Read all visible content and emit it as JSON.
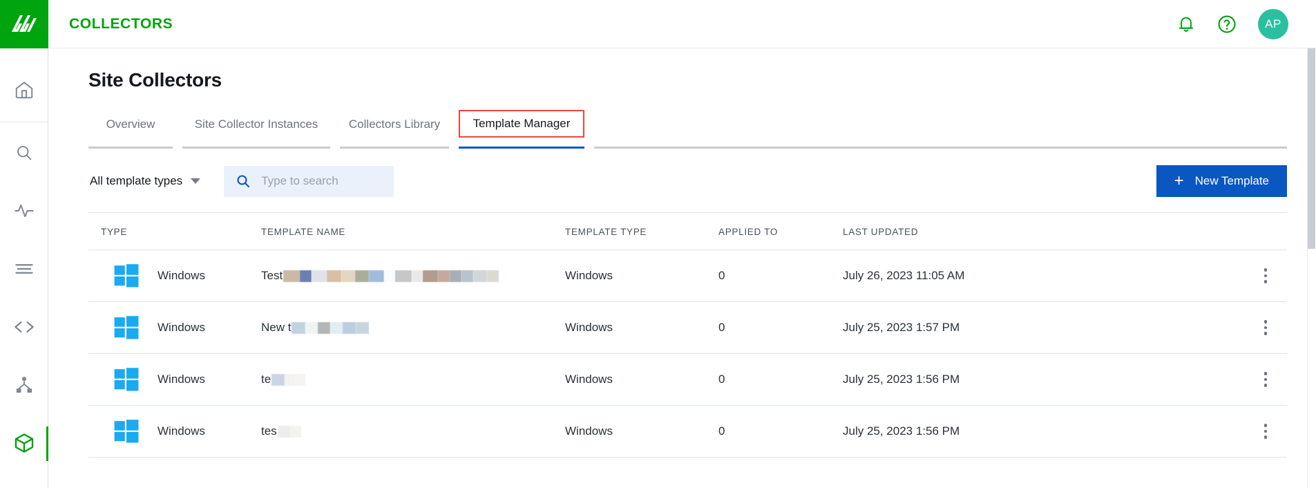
{
  "brand": {
    "app_name": "COLLECTORS",
    "accent_green": "#00a40e",
    "accent_blue": "#0a57c2",
    "highlight_red": "#f2453d",
    "avatar_teal": "#2bbfa2",
    "logo_icon": "zscaler-logo-icon"
  },
  "sidebar": {
    "items": [
      {
        "icon": "home-icon",
        "name": "home"
      },
      {
        "icon": "search-icon",
        "name": "search"
      },
      {
        "icon": "activity-pulse-icon",
        "name": "activity"
      },
      {
        "icon": "list-lines-icon",
        "name": "logs"
      },
      {
        "icon": "code-brackets-icon",
        "name": "code"
      },
      {
        "icon": "hierarchy-icon",
        "name": "topology"
      },
      {
        "icon": "cube-icon",
        "name": "collectors",
        "active": true
      }
    ]
  },
  "topbar": {
    "title": "COLLECTORS",
    "notifications_icon": "bell-icon",
    "help_icon": "question-circle-icon",
    "avatar_initials": "AP"
  },
  "page": {
    "heading": "Site Collectors"
  },
  "tabs": [
    {
      "label": "Overview",
      "active": false
    },
    {
      "label": "Site Collector Instances",
      "active": false
    },
    {
      "label": "Collectors Library",
      "active": false
    },
    {
      "label": "Template Manager",
      "active": true,
      "highlighted": true
    }
  ],
  "toolbar": {
    "filter_label": "All template types",
    "filter_caret_icon": "chevron-down-icon",
    "search_icon": "search-icon",
    "search_value": "",
    "search_placeholder": "Type to search",
    "new_template_label": "New Template",
    "new_template_icon": "plus-icon"
  },
  "table": {
    "columns": [
      "TYPE",
      "TEMPLATE NAME",
      "TEMPLATE TYPE",
      "APPLIED TO",
      "LAST UPDATED"
    ],
    "rows": [
      {
        "os_icon": "windows-logo-icon",
        "type": "Windows",
        "name_visible": "Test",
        "name_redacted": true,
        "template_type": "Windows",
        "applied_to": "0",
        "last_updated": "July 26, 2023 11:05 AM",
        "menu_icon": "kebab-menu-icon"
      },
      {
        "os_icon": "windows-logo-icon",
        "type": "Windows",
        "name_visible": "New t",
        "name_redacted": true,
        "template_type": "Windows",
        "applied_to": "0",
        "last_updated": "July 25, 2023 1:57 PM",
        "menu_icon": "kebab-menu-icon"
      },
      {
        "os_icon": "windows-logo-icon",
        "type": "Windows",
        "name_visible": "te",
        "name_redacted": true,
        "template_type": "Windows",
        "applied_to": "0",
        "last_updated": "July 25, 2023 1:56 PM",
        "menu_icon": "kebab-menu-icon"
      },
      {
        "os_icon": "windows-logo-icon",
        "type": "Windows",
        "name_visible": "tes",
        "name_redacted": true,
        "template_type": "Windows",
        "applied_to": "0",
        "last_updated": "July 25, 2023 1:56 PM",
        "menu_icon": "kebab-menu-icon"
      }
    ]
  }
}
